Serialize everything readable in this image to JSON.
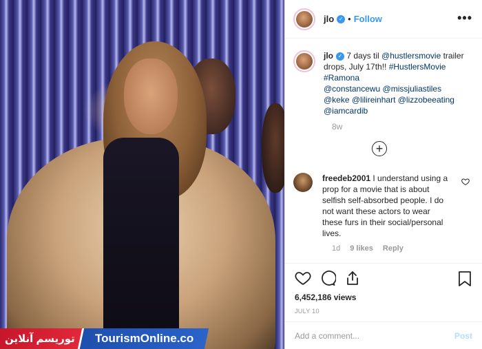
{
  "post": {
    "username": "jlo",
    "follow_label": "Follow",
    "more_label": "•••",
    "separator": "•"
  },
  "caption": {
    "username": "jlo",
    "text_1": " 7 days til ",
    "mention_1": "@hustlersmovie",
    "text_2": " trailer drops, July 17th!! ",
    "hashtag_1": "#HustlersMovie",
    "hashtag_2": "#Ramona",
    "mentions_line_1": "@constancewu @missjuliastiles",
    "mentions_line_2": "@keke @lilireinhart @lizzobeeating",
    "mentions_line_3": "@iamcardib",
    "time": "8w",
    "load_more": "+"
  },
  "comment": {
    "username": "freedeb2001",
    "text": " I understand using a prop for a movie that is about selfish self-absorbed people. I do not want these actors to wear these furs in their social/personal lives.",
    "time": "1d",
    "likes": "9 likes",
    "reply": "Reply"
  },
  "stats": {
    "views": "6,452,186 views",
    "date": "JULY 10"
  },
  "add_comment": {
    "placeholder": "Add a comment...",
    "post_label": "Post"
  },
  "watermark": {
    "fa": "توریسم آنلاین",
    "en": "TourismOnline.co"
  },
  "icons": {
    "verified": "verified-badge-icon",
    "heart": "heart-icon",
    "comment": "comment-icon",
    "share": "share-icon",
    "save": "bookmark-icon"
  },
  "colors": {
    "link": "#3897f0",
    "tag": "#003569",
    "muted": "#999999",
    "post_disabled": "#b2dffc"
  }
}
